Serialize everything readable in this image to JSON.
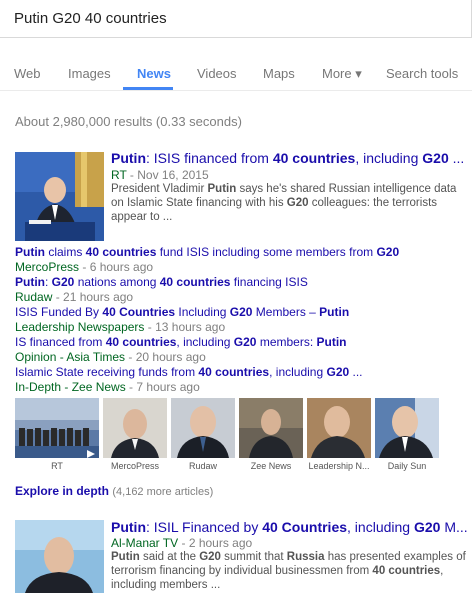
{
  "search": {
    "query": "Putin G20 40 countries"
  },
  "tabs": [
    {
      "label": "Web"
    },
    {
      "label": "Images"
    },
    {
      "label": "News"
    },
    {
      "label": "Videos"
    },
    {
      "label": "Maps"
    },
    {
      "label": "More ▾"
    },
    {
      "label": "Search tools"
    }
  ],
  "stats": "About 2,980,000 results (0.33 seconds)",
  "result1": {
    "title_parts": [
      "Putin",
      ": ISIS financed from ",
      "40 countries",
      ", including ",
      "G20",
      " ..."
    ],
    "source": "RT",
    "date": "Nov 16, 2015",
    "snippet_parts": [
      "President Vladimir ",
      "Putin",
      " says he's shared Russian intelligence data on Islamic State financing with his ",
      "G20",
      " colleagues: the terrorists appear to ..."
    ]
  },
  "related": [
    {
      "title_parts": [
        "Putin",
        " claims ",
        "40 countries",
        " fund ISIS including some members from ",
        "G20"
      ],
      "source": "MercoPress",
      "ago": "6 hours ago"
    },
    {
      "title_parts": [
        "Putin",
        ": ",
        "G20",
        " nations among ",
        "40 countries",
        " financing ISIS"
      ],
      "source": "Rudaw",
      "ago": "21 hours ago"
    },
    {
      "title_parts": [
        "ISIS Funded By ",
        "40 Countries",
        " Including ",
        "G20",
        " Members – ",
        "Putin"
      ],
      "source": "Leadership Newspapers",
      "ago": "13 hours ago"
    },
    {
      "title_parts": [
        "IS financed from ",
        "40 countries",
        ", including ",
        "G20",
        " members: ",
        "Putin"
      ],
      "source": "Opinion - Asia Times",
      "ago": "20 hours ago"
    },
    {
      "title_parts": [
        "Islamic State receiving funds from ",
        "40 countries",
        ", including ",
        "G20",
        " ..."
      ],
      "source": "In-Depth - Zee News",
      "ago": "7 hours ago"
    }
  ],
  "strip": [
    {
      "caption": "RT"
    },
    {
      "caption": "MercoPress"
    },
    {
      "caption": "Rudaw"
    },
    {
      "caption": "Zee News"
    },
    {
      "caption": "Leadership N..."
    },
    {
      "caption": "Daily Sun"
    }
  ],
  "explore": {
    "label": "Explore in depth",
    "count": "(4,162 more articles)"
  },
  "result2": {
    "title_parts": [
      "Putin",
      ": ISIL Financed by ",
      "40 Countries",
      ", including ",
      "G20",
      " M..."
    ],
    "source": "Al-Manar TV",
    "date": "2 hours ago",
    "snippet_parts": [
      "Putin",
      " said at the ",
      "G20",
      " summit that ",
      "Russia",
      " has presented examples of terrorism financing by individual businessmen from ",
      "40 countries",
      ", including members ..."
    ]
  },
  "colors": {
    "link": "#1a0dab",
    "source": "#006621",
    "accent": "#4285f4"
  }
}
